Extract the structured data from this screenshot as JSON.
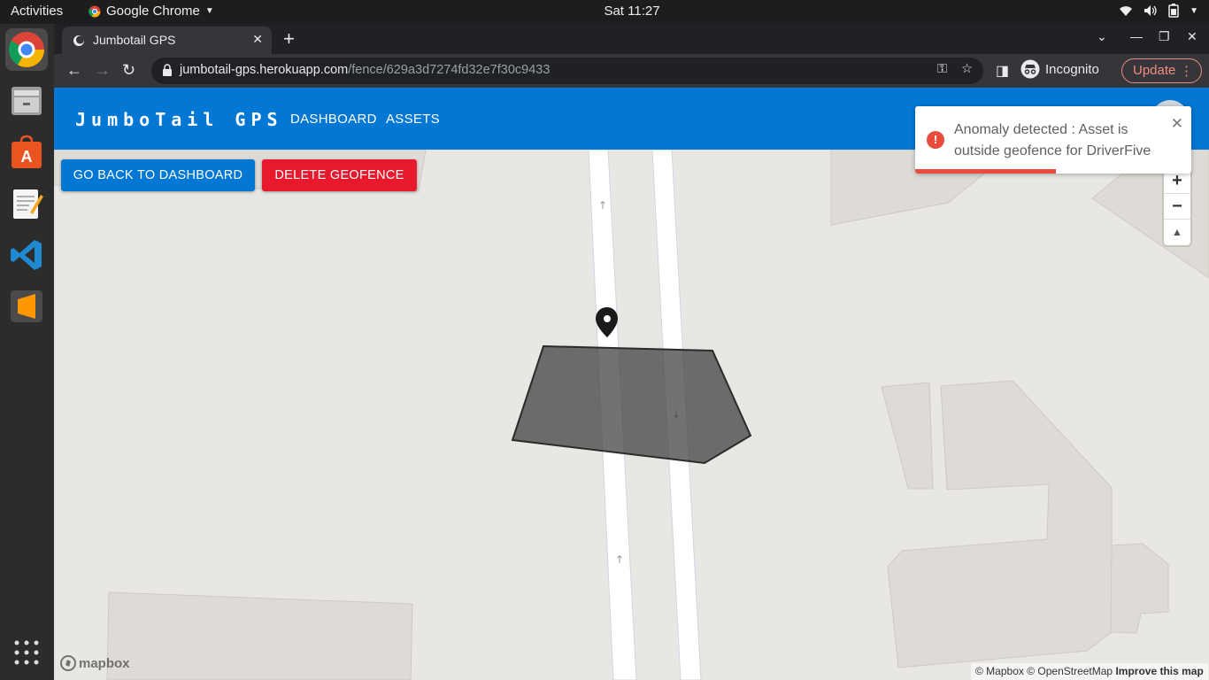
{
  "system": {
    "activities": "Activities",
    "app_name": "Google Chrome",
    "clock": "Sat 11:27",
    "dock_items": [
      "chrome-icon",
      "files-icon",
      "software-center-icon",
      "text-editor-icon",
      "vscode-icon",
      "sublime-text-icon",
      "show-apps-icon"
    ]
  },
  "browser": {
    "tab_title": "Jumbotail GPS",
    "url_host": "jumbotail-gps.herokuapp.com",
    "url_path": "/fence/629a3d7274fd32e7f30c9433",
    "incognito_label": "Incognito",
    "update_label": "Update"
  },
  "app": {
    "brand": "JumboTail GPS",
    "nav": [
      "DASHBOARD",
      "ASSETS"
    ],
    "back_button": "GO BACK TO DASHBOARD",
    "delete_button": "DELETE GEOFENCE"
  },
  "toast": {
    "message": "Anomaly detected : Asset is outside geofence for DriverFive",
    "progress": 0.51
  },
  "map": {
    "zoom_in": "+",
    "zoom_out": "−",
    "compass": "▲",
    "logo": "mapbox",
    "attribution": [
      "© Mapbox",
      "© OpenStreetMap",
      "Improve this map"
    ]
  },
  "colors": {
    "primary": "#0277d4",
    "danger": "#e8192c",
    "toast_error": "#e74c3c"
  }
}
